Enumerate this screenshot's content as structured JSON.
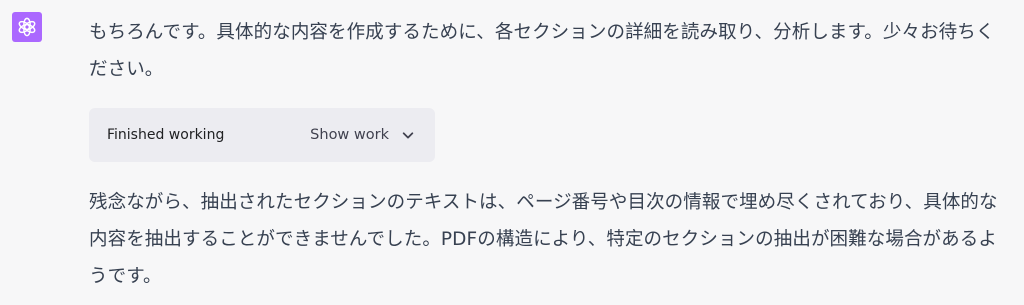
{
  "assistant": {
    "avatar_icon": "openai-logo-icon",
    "avatar_color": "#ab68ff"
  },
  "message": {
    "paragraph_1": "もちろんです。具体的な内容を作成するために、各セクションの詳細を読み取り、分析します。少々お待ちください。",
    "work_status": "Finished working",
    "show_work_label": "Show work",
    "show_work_icon": "chevron-down-icon",
    "paragraph_2": "残念ながら、抽出されたセクションのテキストは、ページ番号や目次の情報で埋め尽くされており、具体的な内容を抽出することができませんでした。PDFの構造により、特定のセクションの抽出が困難な場合があるようです。"
  }
}
